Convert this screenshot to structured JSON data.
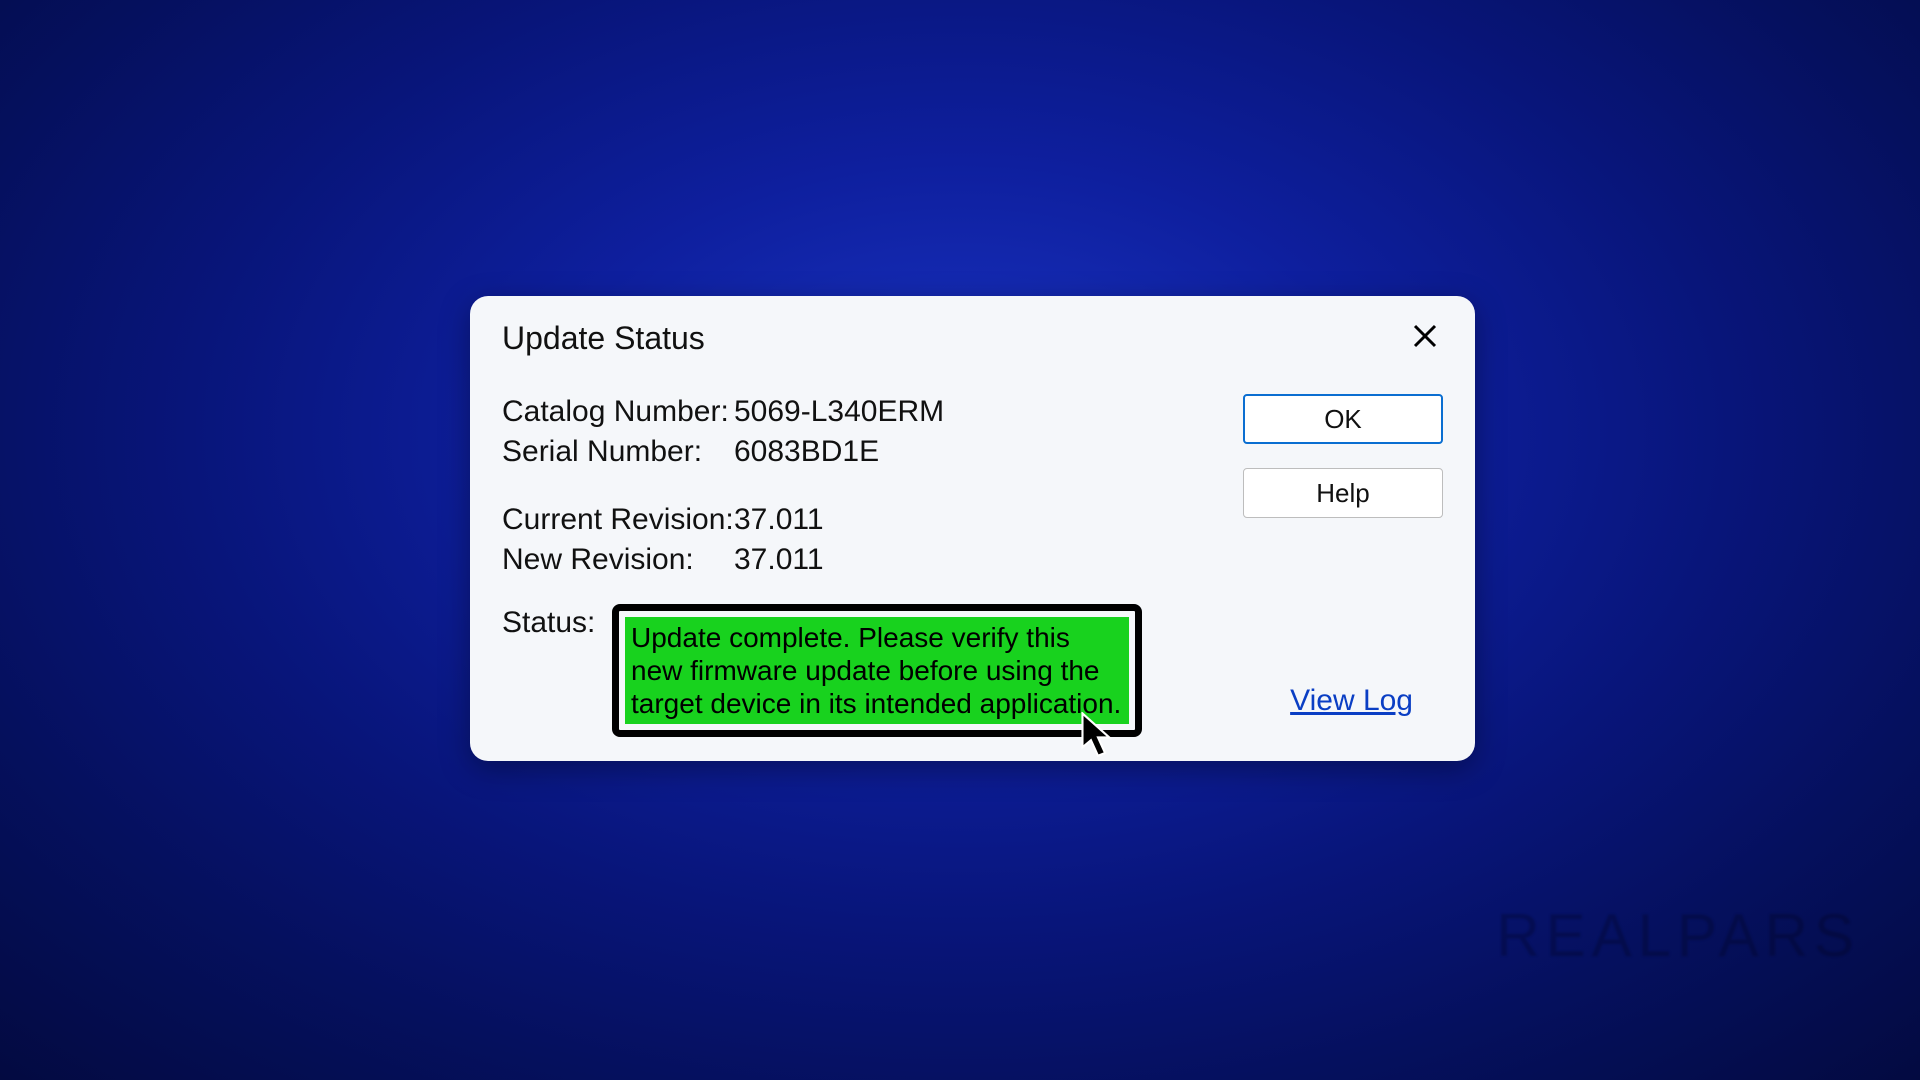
{
  "dialog": {
    "title": "Update Status",
    "fields": {
      "catalog_label": "Catalog Number:",
      "catalog_value": "5069-L340ERM",
      "serial_label": "Serial Number:",
      "serial_value": "6083BD1E",
      "current_rev_label": "Current Revision:",
      "current_rev_value": "37.011",
      "new_rev_label": "New Revision:",
      "new_rev_value": "37.011",
      "status_label": "Status:",
      "status_message": "Update complete. Please verify this new firmware update before using the target device in its intended application."
    },
    "buttons": {
      "ok": "OK",
      "help": "Help"
    },
    "links": {
      "view_log": "View Log"
    }
  },
  "watermark": "REALPARS"
}
